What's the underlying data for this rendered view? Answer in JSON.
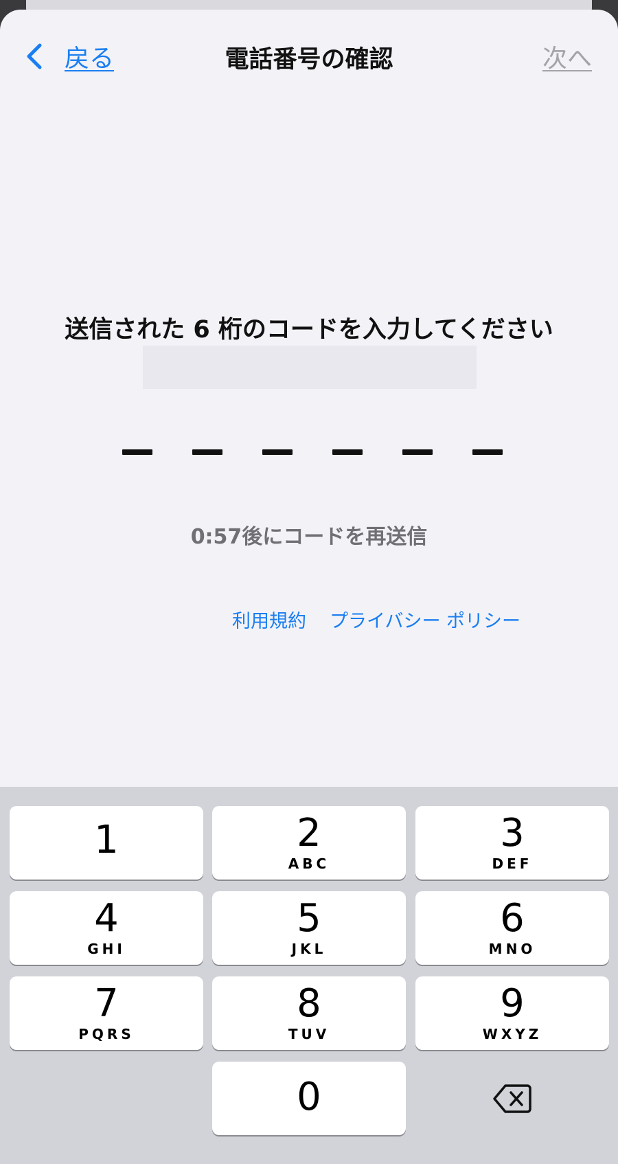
{
  "nav": {
    "back_label": "戻る",
    "title": "電話番号の確認",
    "next_label": "次へ"
  },
  "prompt": "送信された 6 桁のコードを入力してください",
  "code": {
    "length": 6,
    "value": ""
  },
  "resend": "0:57後にコードを再送信",
  "links": {
    "terms": "利用規約",
    "privacy": "プライバシー ポリシー"
  },
  "keyboard": {
    "keys": [
      {
        "num": "1",
        "letters": ""
      },
      {
        "num": "2",
        "letters": "ABC"
      },
      {
        "num": "3",
        "letters": "DEF"
      },
      {
        "num": "4",
        "letters": "GHI"
      },
      {
        "num": "5",
        "letters": "JKL"
      },
      {
        "num": "6",
        "letters": "MNO"
      },
      {
        "num": "7",
        "letters": "PQRS"
      },
      {
        "num": "8",
        "letters": "TUV"
      },
      {
        "num": "9",
        "letters": "WXYZ"
      },
      {
        "num": "0",
        "letters": ""
      }
    ],
    "delete_icon": "delete-backward-icon"
  },
  "colors": {
    "accent": "#1a7ef1",
    "disabled": "#a3a3a8",
    "background": "#f2f2f7",
    "keyboard": "#d1d3d9"
  }
}
